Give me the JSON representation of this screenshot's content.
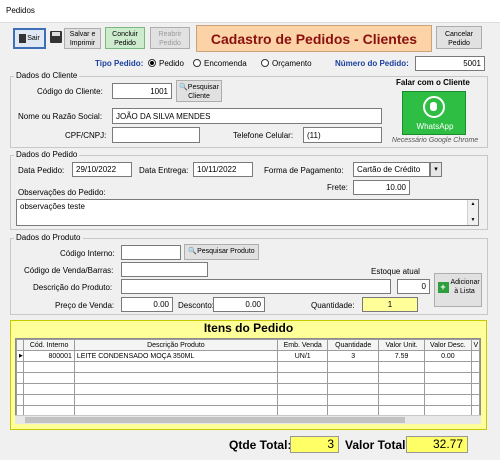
{
  "window": {
    "title": "Pedidos"
  },
  "toolbar": {
    "sair": "Sair",
    "salvar": "Salvar e Imprimir",
    "concluir": "Concluir Pedido",
    "reabrir": "Reabrir Pedido",
    "cancelar": "Cancelar Pedido"
  },
  "form_title": "Cadastro de Pedidos - Clientes",
  "tipo_pedido": {
    "label": "Tipo Pedido:",
    "options": [
      "Pedido",
      "Encomenda",
      "Orçamento"
    ],
    "selected": "Pedido"
  },
  "numero_pedido": {
    "label": "Número do Pedido:",
    "value": "5001"
  },
  "cliente": {
    "legend": "Dados do Cliente",
    "codigo_label": "Código do Cliente:",
    "codigo_value": "1001",
    "pesquisar_label": "Pesquisar Cliente",
    "nome_label": "Nome ou Razão Social:",
    "nome_value": "JOÃO DA SILVA MENDES",
    "cpf_label": "CPF/CNPJ:",
    "cpf_value": "",
    "telefone_label": "Telefone Celular:",
    "telefone_value": "(11)",
    "falar_label": "Falar com o Cliente",
    "whatsapp_text": "WhatsApp",
    "chrome_note": "Necessário Google Chrome"
  },
  "pedido": {
    "legend": "Dados do Pedido",
    "data_pedido_label": "Data Pedido:",
    "data_pedido_value": "29/10/2022",
    "data_entrega_label": "Data Entrega:",
    "data_entrega_value": "10/11/2022",
    "forma_pagamento_label": "Forma de Pagamento:",
    "forma_pagamento_value": "Cartão de Crédito",
    "frete_label": "Frete:",
    "frete_value": "10.00",
    "observacoes_label": "Observações do Pedido:",
    "observacoes_value": "observações teste"
  },
  "produto": {
    "legend": "Dados do Produto",
    "codigo_interno_label": "Código Interno:",
    "codigo_interno_value": "",
    "pesquisar_label": "Pesquisar Produto",
    "codigo_barras_label": "Código de Venda/Barras:",
    "codigo_barras_value": "",
    "descricao_label": "Descrição do Produto:",
    "descricao_value": "",
    "estoque_label": "Estoque atual",
    "estoque_value": "0",
    "preco_label": "Preço de Venda:",
    "preco_value": "0.00",
    "desconto_label": "Desconto:",
    "desconto_value": "0.00",
    "quantidade_label": "Quantidade:",
    "quantidade_value": "1",
    "adicionar_label": "Adicionar à Lista"
  },
  "itens": {
    "title": "Itens do Pedido",
    "columns": [
      "Cód. Interno",
      "Descrição Produto",
      "Emb. Venda",
      "Quantidade",
      "Valor Unit.",
      "Valor Desc.",
      "V"
    ],
    "rows": [
      [
        "800001",
        "LEITE CONDENSADO MOÇA 350ML",
        "UN/1",
        "3",
        "7.59",
        "0.00",
        ""
      ]
    ]
  },
  "totais": {
    "qtde_label": "Qtde Total:",
    "qtde_value": "3",
    "valor_label": "Valor Total:",
    "valor_value": "32.77"
  }
}
